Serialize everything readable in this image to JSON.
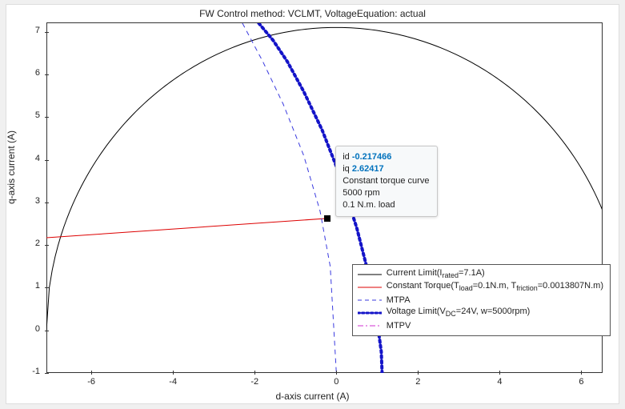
{
  "chart_data": {
    "type": "line",
    "title": "FW Control method: VCLMT, VoltageEquation: actual",
    "xlabel": "d-axis current (A)",
    "ylabel": "q-axis current (A)",
    "xlim": [
      -7.1,
      6.5
    ],
    "ylim": [
      -1,
      7.2
    ],
    "xticks": [
      -6,
      -4,
      -2,
      0,
      2,
      4,
      6
    ],
    "yticks": [
      -1,
      0,
      1,
      2,
      3,
      4,
      5,
      6,
      7
    ],
    "series": [
      {
        "name": "Current Limit(I_rated=7.1A)",
        "style": "solid-black",
        "note": "circle radius 7.1 centered at origin",
        "x": [
          -7.1,
          -6.5,
          -5.5,
          -4.0,
          -2.0,
          0.0,
          2.0,
          4.0,
          5.5,
          6.5,
          7.1
        ],
        "y": [
          0.0,
          2.85,
          4.49,
          5.86,
          6.81,
          7.1,
          6.81,
          5.86,
          4.49,
          2.85,
          0.0
        ]
      },
      {
        "name": "Constant Torque(T_load=0.1N.m, T_friction=0.0013807N.m)",
        "style": "solid-red",
        "x": [
          -7.1,
          -0.217
        ],
        "y": [
          2.17,
          2.624
        ]
      },
      {
        "name": "MTPA",
        "style": "dashed-blue",
        "x": [
          -2.3,
          -1.8,
          -1.3,
          -0.8,
          -0.4,
          -0.15,
          0.0
        ],
        "y": [
          7.2,
          6.3,
          5.3,
          4.1,
          2.8,
          1.5,
          -1.0
        ]
      },
      {
        "name": "Voltage Limit(V_DC=24V, w=5000rpm)",
        "style": "dotted-blue-thick",
        "x": [
          -1.9,
          -1.55,
          -1.2,
          -0.8,
          -0.35,
          0.1,
          0.5,
          0.82,
          1.0,
          1.1,
          1.12
        ],
        "y": [
          7.2,
          6.8,
          6.3,
          5.6,
          4.7,
          3.6,
          2.4,
          1.2,
          0.2,
          -0.5,
          -1.0
        ]
      },
      {
        "name": "MTPV",
        "style": "dashdot-magenta",
        "x": [],
        "y": []
      }
    ],
    "datatip": {
      "id_label": "id",
      "id_value": "-0.217466",
      "iq_label": "iq",
      "iq_value": "2.62417",
      "line1": "Constant torque curve",
      "line2": "5000 rpm",
      "line3": "0.1 N.m. load",
      "point": {
        "x": -0.217466,
        "y": 2.62417
      }
    }
  },
  "legend": {
    "items": [
      "Current Limit(I_rated=7.1A)",
      "Constant Torque(T_load=0.1N.m, T_friction=0.0013807N.m)",
      "MTPA",
      "Voltage Limit(V_DC=24V, w=5000rpm)",
      "MTPV"
    ],
    "items_html": [
      "Current Limit(I<sub>rated</sub>=7.1A)",
      "Constant Torque(T<sub>load</sub>=0.1N.m, T<sub>friction</sub>=0.0013807N.m)",
      "MTPA",
      "Voltage Limit(V<sub>DC</sub>=24V, w=5000rpm)",
      "MTPV"
    ]
  }
}
